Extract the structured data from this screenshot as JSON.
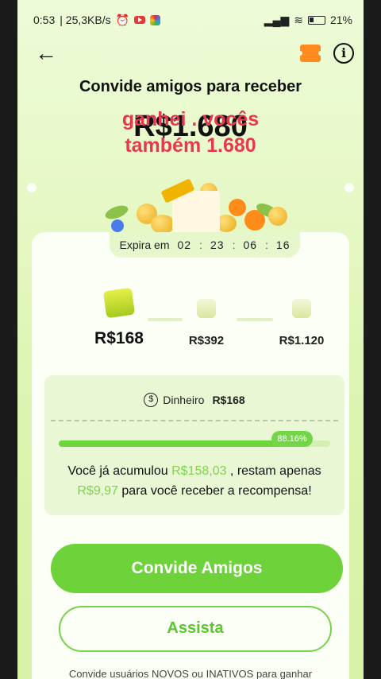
{
  "status_bar": {
    "time": "0:53",
    "network_speed": "| 25,3KB/s",
    "battery": "21%",
    "icons": [
      "alarm-icon",
      "youtube-icon",
      "app-icon",
      "signal-icon",
      "wifi-icon",
      "battery-icon"
    ]
  },
  "header": {
    "back_icon": "arrow-left-icon",
    "ticket_icon": "ticket-icon",
    "info_label": "i"
  },
  "hero": {
    "title": "Convide amigos para receber",
    "amount": "R$1.680",
    "overlay_line1": "ganhei . vocês",
    "overlay_line2": "também 1.680"
  },
  "expiry": {
    "label": "Expira em",
    "hours": "02",
    "minutes": "23",
    "seconds": "06",
    "frames": "16"
  },
  "milestones": [
    {
      "label": "R$168",
      "state": "active"
    },
    {
      "label": "R$392",
      "state": "locked"
    },
    {
      "label": "R$1.120",
      "state": "locked"
    }
  ],
  "reward": {
    "cash_label": "Dinheiro",
    "cash_value": "R$168",
    "progress_percent": 88.16,
    "progress_label": "88.16%",
    "message_part1": "Você já acumulou ",
    "accumulated": "R$158,03",
    "message_part2": " , restam apenas",
    "remaining": "R$9,97",
    "message_part3": " para você receber a recompensa!"
  },
  "buttons": {
    "invite": "Convide Amigos",
    "watch": "Assista"
  },
  "footnote": "Convide usuários NOVOS ou INATIVOS para ganhar",
  "colors": {
    "accent_green": "#6ed33a",
    "overlay_red": "#e53950",
    "highlight_green": "#7ed54a"
  }
}
